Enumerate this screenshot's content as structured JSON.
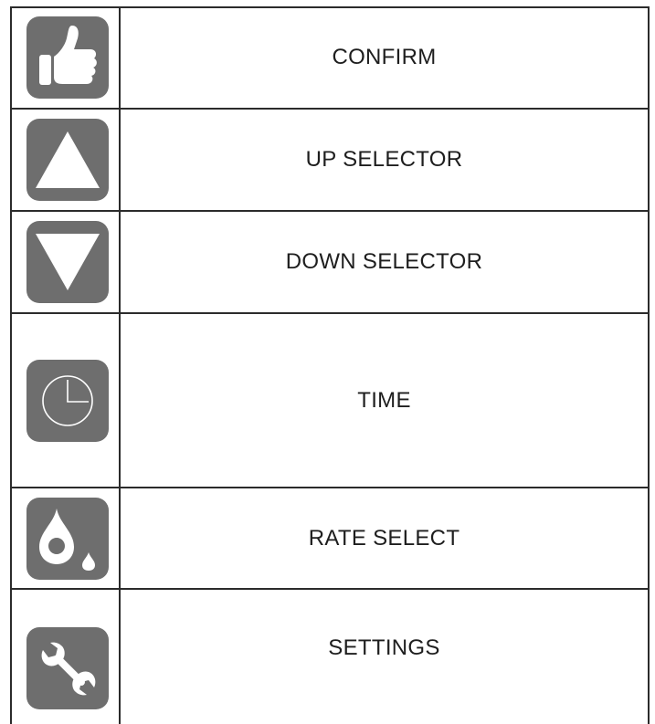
{
  "rows": [
    {
      "label": "CONFIRM",
      "icon": "thumbs-up-icon"
    },
    {
      "label": "UP SELECTOR",
      "icon": "triangle-up-icon"
    },
    {
      "label": "DOWN SELECTOR",
      "icon": "triangle-down-icon"
    },
    {
      "label": "TIME",
      "icon": "clock-icon"
    },
    {
      "label": "RATE SELECT",
      "icon": "drops-icon"
    },
    {
      "label": "SETTINGS",
      "icon": "wrench-icon"
    }
  ],
  "colors": {
    "button_fill": "#6e6e6e",
    "icon_fill": "#ffffff",
    "border": "#2b2b2b",
    "text": "#1e1e1e"
  }
}
